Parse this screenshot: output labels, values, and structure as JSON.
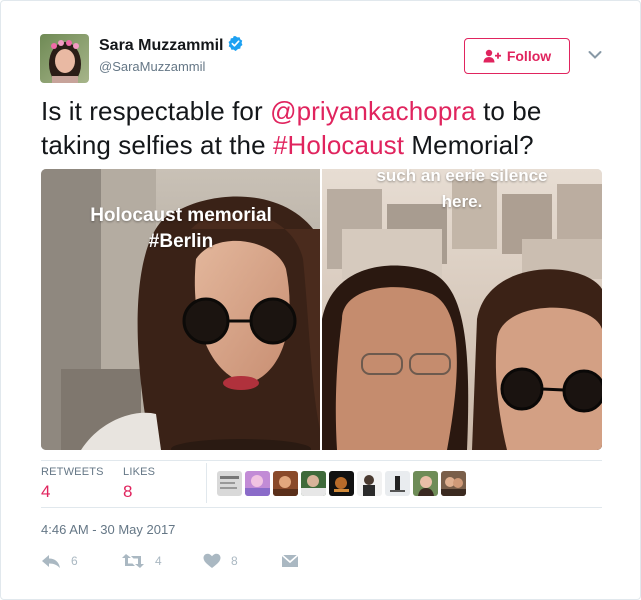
{
  "author": {
    "name": "Sara Muzzammil",
    "handle": "@SaraMuzzammil"
  },
  "follow_label": "Follow",
  "tweet": {
    "text_1": "Is it respectable for ",
    "mention": "@priyankachopra",
    "text_2": " to be taking selfies at the ",
    "hashtag": "#Holocaust",
    "text_3": " Memorial?"
  },
  "media": {
    "left_caption_line1": "Holocaust memorial",
    "left_caption_line2": "#Berlin",
    "right_caption_line1": "such an eerie silence",
    "right_caption_line2": "here."
  },
  "stats": {
    "retweets_label": "RETWEETS",
    "retweets_count": "4",
    "likes_label": "LIKES",
    "likes_count": "8"
  },
  "timestamp": "4:46 AM - 30 May 2017",
  "actions": {
    "reply_count": "6",
    "retweet_count": "4",
    "like_count": "8"
  },
  "colors": {
    "accent": "#e0245e",
    "verified": "#1da1f2",
    "muted": "#657786",
    "icon_gray": "#aab8c2"
  }
}
